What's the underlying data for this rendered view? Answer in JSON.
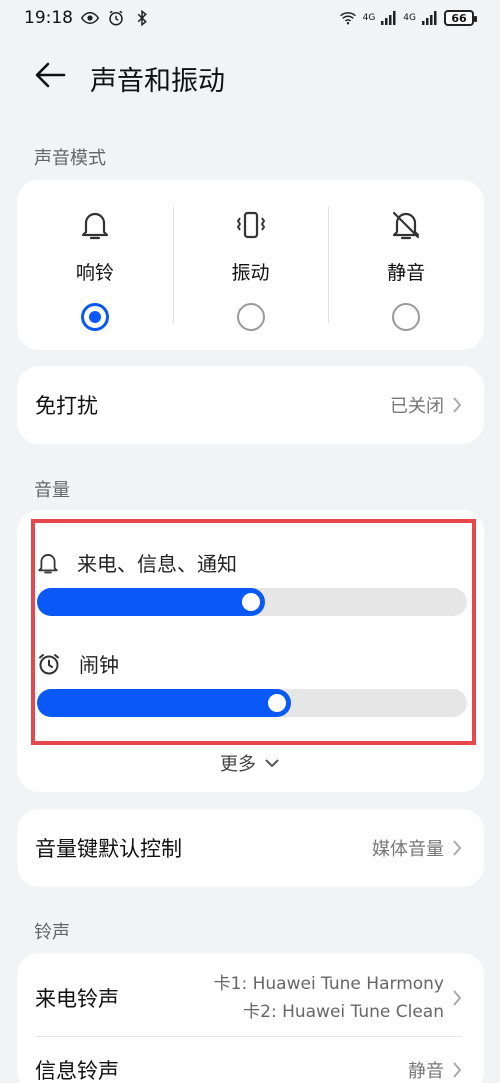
{
  "status_bar": {
    "time": "19:18",
    "battery": "66",
    "signal_1": "4G",
    "signal_2": "4G"
  },
  "header": {
    "title": "声音和振动"
  },
  "sound_mode": {
    "section_label": "声音模式",
    "modes": [
      {
        "label": "响铃",
        "icon": "bell-icon",
        "selected": true
      },
      {
        "label": "振动",
        "icon": "vibrate-icon",
        "selected": false
      },
      {
        "label": "静音",
        "icon": "bell-muted-icon",
        "selected": false
      }
    ]
  },
  "dnd": {
    "label": "免打扰",
    "value": "已关闭"
  },
  "volume": {
    "section_label": "音量",
    "sliders": [
      {
        "label": "来电、信息、通知",
        "icon": "bell-icon",
        "level": 0.53
      },
      {
        "label": "闹钟",
        "icon": "alarm-clock-icon",
        "level": 0.59
      }
    ],
    "more_label": "更多"
  },
  "volume_key": {
    "label": "音量键默认控制",
    "value": "媒体音量"
  },
  "ringtone": {
    "section_label": "铃声",
    "call_label": "来电铃声",
    "call_values": [
      "卡1: Huawei Tune Harmony",
      "卡2: Huawei Tune Clean"
    ],
    "message_label": "信息铃声",
    "message_value": "静音"
  },
  "colors": {
    "accent": "#0a59f7",
    "highlight": "#e5484d",
    "background": "#f1f3f5"
  }
}
